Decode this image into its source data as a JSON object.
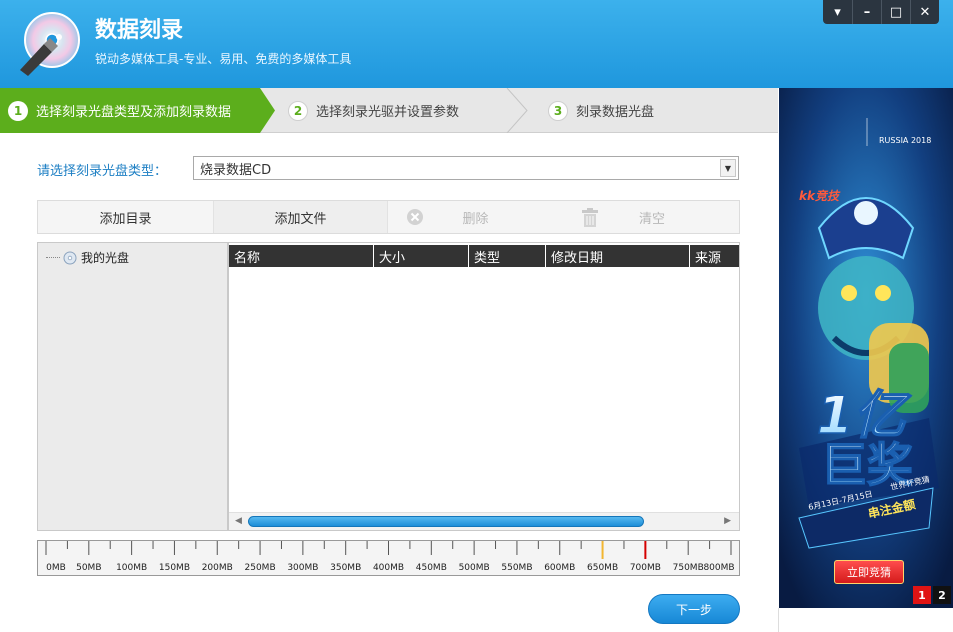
{
  "header": {
    "title": "数据刻录",
    "subtitle": "锐动多媒体工具-专业、易用、免费的多媒体工具",
    "window_controls": [
      "▾",
      "–",
      "□",
      "✕"
    ]
  },
  "steps": [
    {
      "num": "1",
      "label": "选择刻录光盘类型及添加刻录数据"
    },
    {
      "num": "2",
      "label": "选择刻录光驱并设置参数"
    },
    {
      "num": "3",
      "label": "刻录数据光盘"
    }
  ],
  "disc_type": {
    "label": "请选择刻录光盘类型：",
    "value": "烧录数据CD"
  },
  "toolbar": {
    "add_dir": "添加目录",
    "add_file": "添加文件",
    "delete": "删除",
    "clear": "清空"
  },
  "tree": {
    "root": "我的光盘"
  },
  "file_list": {
    "columns": [
      "名称",
      "大小",
      "类型",
      "修改日期",
      "来源"
    ]
  },
  "capacity": {
    "labels": [
      "0MB",
      "50MB",
      "100MB",
      "150MB",
      "200MB",
      "250MB",
      "300MB",
      "350MB",
      "400MB",
      "450MB",
      "500MB",
      "550MB",
      "600MB",
      "650MB",
      "700MB",
      "750MB",
      "800MB"
    ],
    "yellow_marker_mb": 650,
    "red_marker_mb": 700
  },
  "next_button": "下一步",
  "ad": {
    "brand": "kk竞技",
    "event": "RUSSIA 2018",
    "headline_1": "1亿",
    "headline_2": "巨奖",
    "dates": "6月13日-7月15日",
    "promo_1": "世界杯竞猜",
    "promo_2": "串注金额",
    "cta": "立即竞猜",
    "pages": [
      "1",
      "2"
    ]
  }
}
